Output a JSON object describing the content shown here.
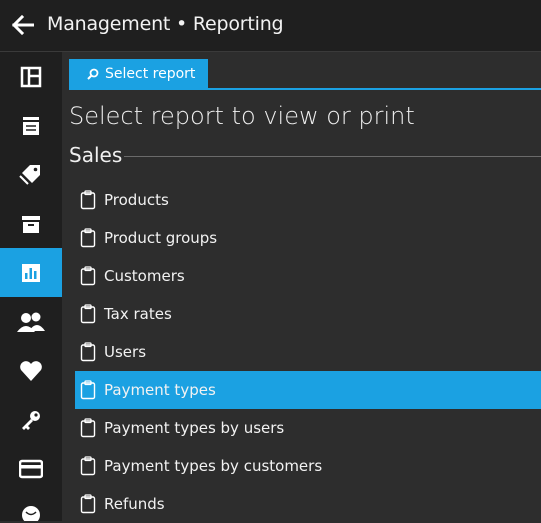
{
  "header": {
    "title": "Management • Reporting",
    "back_icon": "arrow-left-icon"
  },
  "sidebar": {
    "items": [
      {
        "name": "dashboard",
        "icon": "dashboard-icon",
        "active": false
      },
      {
        "name": "documents",
        "icon": "document-list-icon",
        "active": false
      },
      {
        "name": "products",
        "icon": "price-tag-icon",
        "active": false
      },
      {
        "name": "stock",
        "icon": "archive-box-icon",
        "active": false
      },
      {
        "name": "reporting",
        "icon": "bar-chart-icon",
        "active": true
      },
      {
        "name": "users",
        "icon": "users-icon",
        "active": false
      },
      {
        "name": "loyalty",
        "icon": "heart-icon",
        "active": false
      },
      {
        "name": "security",
        "icon": "key-icon",
        "active": false
      },
      {
        "name": "payment",
        "icon": "credit-card-icon",
        "active": false
      },
      {
        "name": "more",
        "icon": "globe-icon",
        "active": false
      }
    ]
  },
  "tab": {
    "label": "Select report",
    "icon": "search-icon"
  },
  "main": {
    "heading": "Select report to view or print",
    "section": "Sales",
    "reports": [
      {
        "label": "Products",
        "selected": false
      },
      {
        "label": "Product groups",
        "selected": false
      },
      {
        "label": "Customers",
        "selected": false
      },
      {
        "label": "Tax rates",
        "selected": false
      },
      {
        "label": "Users",
        "selected": false
      },
      {
        "label": "Payment types",
        "selected": true
      },
      {
        "label": "Payment types by users",
        "selected": false
      },
      {
        "label": "Payment types by customers",
        "selected": false
      },
      {
        "label": "Refunds",
        "selected": false
      }
    ]
  },
  "colors": {
    "accent": "#1ba1e2",
    "background": "#2d2d2d",
    "bar": "#1f1f1f"
  }
}
